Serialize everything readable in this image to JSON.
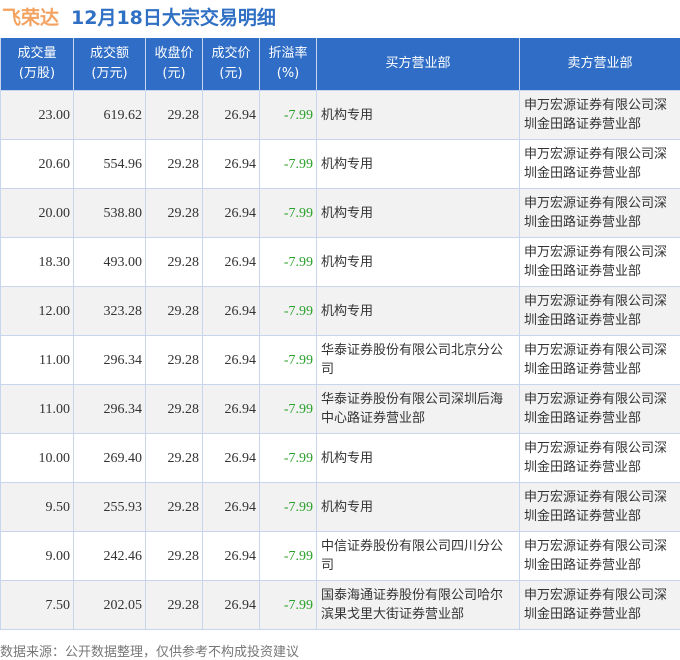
{
  "title": {
    "stock": "飞荣达",
    "subtitle": "12月18日大宗交易明细"
  },
  "columns": [
    "成交量\n(万股)",
    "成交额\n(万元)",
    "收盘价\n(元)",
    "成交价\n(元)",
    "折溢率\n(%)",
    "买方营业部",
    "卖方营业部"
  ],
  "rows": [
    [
      "23.00",
      "619.62",
      "29.28",
      "26.94",
      "-7.99",
      "机构专用",
      "申万宏源证券有限公司深圳金田路证券营业部"
    ],
    [
      "20.60",
      "554.96",
      "29.28",
      "26.94",
      "-7.99",
      "机构专用",
      "申万宏源证券有限公司深圳金田路证券营业部"
    ],
    [
      "20.00",
      "538.80",
      "29.28",
      "26.94",
      "-7.99",
      "机构专用",
      "申万宏源证券有限公司深圳金田路证券营业部"
    ],
    [
      "18.30",
      "493.00",
      "29.28",
      "26.94",
      "-7.99",
      "机构专用",
      "申万宏源证券有限公司深圳金田路证券营业部"
    ],
    [
      "12.00",
      "323.28",
      "29.28",
      "26.94",
      "-7.99",
      "机构专用",
      "申万宏源证券有限公司深圳金田路证券营业部"
    ],
    [
      "11.00",
      "296.34",
      "29.28",
      "26.94",
      "-7.99",
      "华泰证券股份有限公司北京分公司",
      "申万宏源证券有限公司深圳金田路证券营业部"
    ],
    [
      "11.00",
      "296.34",
      "29.28",
      "26.94",
      "-7.99",
      "华泰证券股份有限公司深圳后海中心路证券营业部",
      "申万宏源证券有限公司深圳金田路证券营业部"
    ],
    [
      "10.00",
      "269.40",
      "29.28",
      "26.94",
      "-7.99",
      "机构专用",
      "申万宏源证券有限公司深圳金田路证券营业部"
    ],
    [
      "9.50",
      "255.93",
      "29.28",
      "26.94",
      "-7.99",
      "机构专用",
      "申万宏源证券有限公司深圳金田路证券营业部"
    ],
    [
      "9.00",
      "242.46",
      "29.28",
      "26.94",
      "-7.99",
      "中信证券股份有限公司四川分公司",
      "申万宏源证券有限公司深圳金田路证券营业部"
    ],
    [
      "7.50",
      "202.05",
      "29.28",
      "26.94",
      "-7.99",
      "国泰海通证券股份有限公司哈尔滨果戈里大街证券营业部",
      "申万宏源证券有限公司深圳金田路证券营业部"
    ]
  ],
  "footer": "数据来源：公开数据整理，仅供参考不构成投资建议",
  "colors": {
    "header": "#2f6dc6",
    "negative": "#2aa02a",
    "stock": "#f4a260"
  }
}
